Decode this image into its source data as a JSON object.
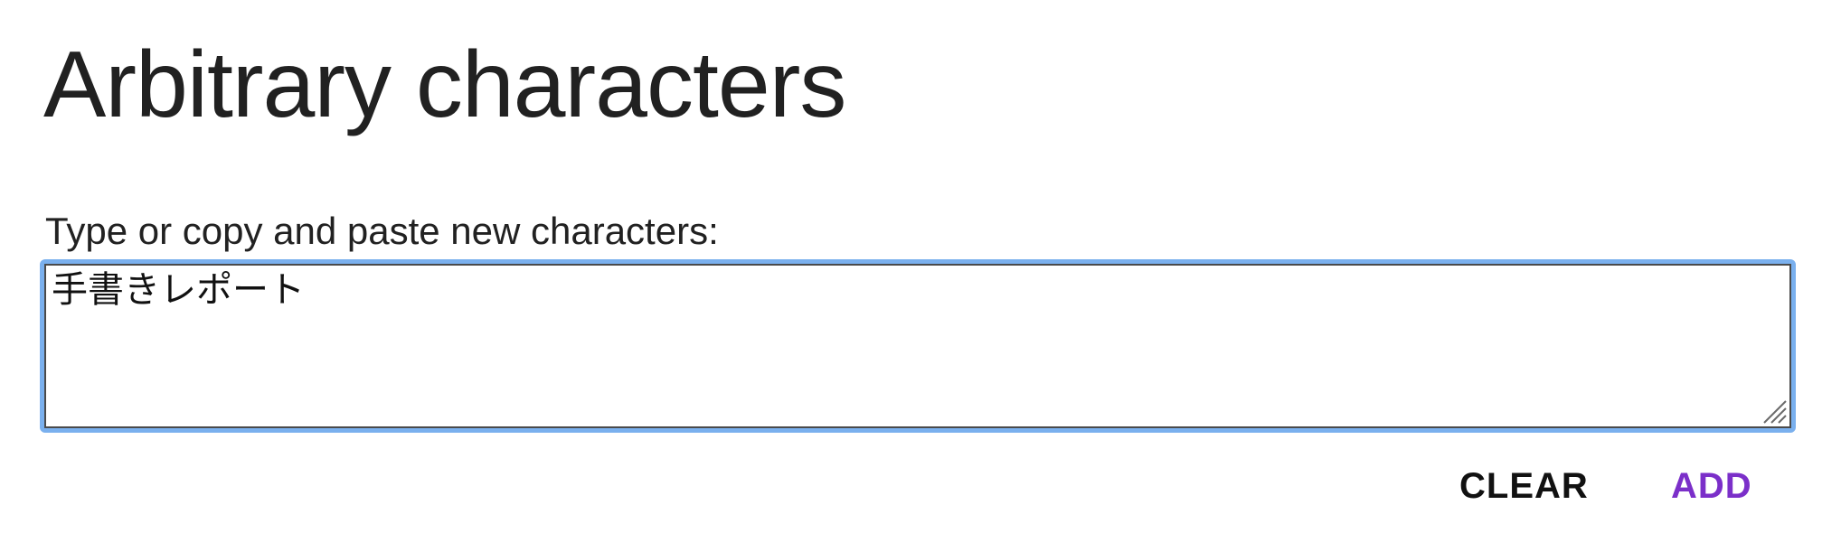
{
  "page": {
    "title": "Arbitrary characters"
  },
  "form": {
    "label": "Type or copy and paste new characters:",
    "value": "手書きレポート",
    "focus_color": "#7ab0ee"
  },
  "actions": {
    "clear_label": "CLEAR",
    "add_label": "ADD",
    "add_color": "#7b2fc9"
  },
  "icons": {
    "resize": "resize-grip-icon"
  }
}
